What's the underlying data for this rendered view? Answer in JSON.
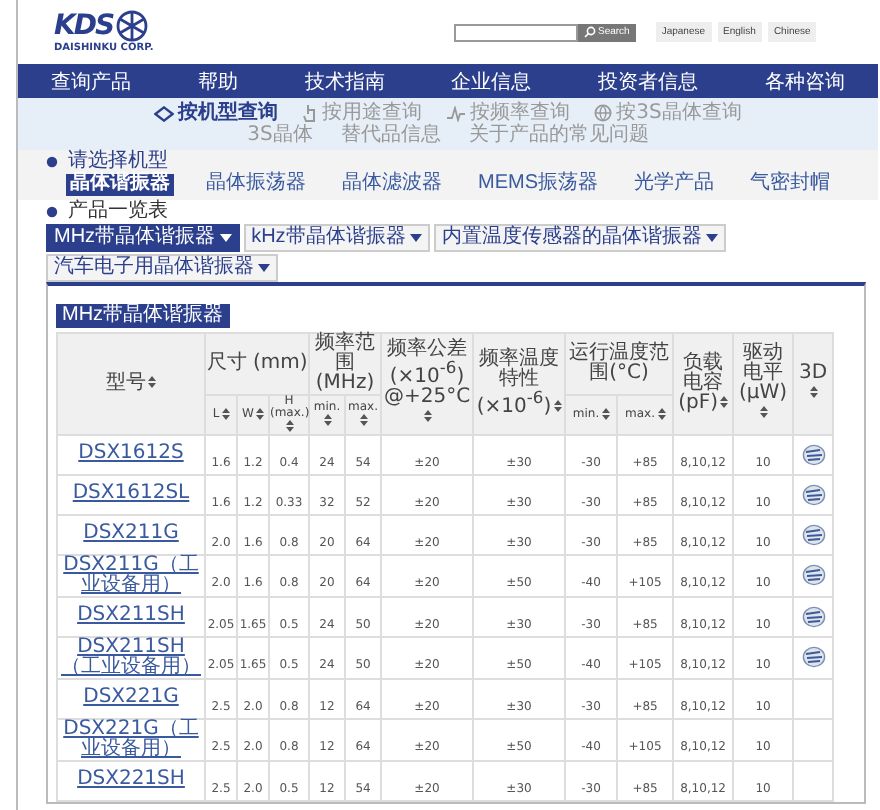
{
  "header": {
    "logo": {
      "mark": "KDS",
      "company": "DAISHINKU CORP."
    },
    "search": {
      "button": "Search"
    },
    "languages": [
      "Japanese",
      "English",
      "Chinese"
    ]
  },
  "nav": [
    "查询产品",
    "帮助",
    "技术指南",
    "企业信息",
    "投资者信息",
    "各种咨询"
  ],
  "search_modes": [
    {
      "label": "按机型查询",
      "selected": true
    },
    {
      "label": "按用途查询",
      "selected": false
    },
    {
      "label": "按频率查询",
      "selected": false
    },
    {
      "label": "按3S晶体查询",
      "selected": false
    }
  ],
  "sub_links": [
    "3S晶体",
    "替代品信息",
    "关于产品的常见问题"
  ],
  "category": {
    "label": "请选择机型",
    "items": [
      {
        "label": "晶体谐振器",
        "selected": true
      },
      {
        "label": "晶体振荡器",
        "selected": false
      },
      {
        "label": "晶体滤波器",
        "selected": false
      },
      {
        "label": "MEMS振荡器",
        "selected": false
      },
      {
        "label": "光学产品",
        "selected": false
      },
      {
        "label": "气密封帽",
        "selected": false
      }
    ]
  },
  "product_list": {
    "title": "产品一览表",
    "tabs": [
      {
        "label": "MHz带晶体谐振器",
        "selected": true
      },
      {
        "label": "kHz带晶体谐振器",
        "selected": false
      },
      {
        "label": "内置温度传感器的晶体谐振器",
        "selected": false
      },
      {
        "label": "汽车电子用晶体谐振器",
        "selected": false
      }
    ],
    "subtab": "MHz带晶体谐振器"
  },
  "table": {
    "columns": [
      {
        "label": "型号"
      },
      {
        "label": "尺寸 (mm)",
        "colspan": 3,
        "children": [
          {
            "label": "L"
          },
          {
            "label": "W"
          },
          {
            "label": "H (max.)"
          }
        ]
      },
      {
        "label": "频率范围(MHz)",
        "colspan": 2,
        "children": [
          {
            "label": "min."
          },
          {
            "label": "max."
          }
        ]
      },
      {
        "label": "频率公差 (×10$^{-6}$) @+25°C"
      },
      {
        "label": "频率温度特性 (×10$^{-6}$)"
      },
      {
        "label": "运行温度范围(°C)",
        "colspan": 2,
        "children": [
          {
            "label": "min."
          },
          {
            "label": "max."
          }
        ]
      },
      {
        "label": "负载电容 (pF)"
      },
      {
        "label": "驱动电平 (μW)"
      },
      {
        "label": "3D"
      }
    ],
    "rows": [
      {
        "cells": [
          "DSX1612S",
          "1.6",
          "1.2",
          "0.4",
          "24",
          "54",
          "±20",
          "±30",
          "-30",
          "+85",
          "8,10,12",
          "10"
        ],
        "model_3d": true
      },
      {
        "cells": [
          "DSX1612SL",
          "1.6",
          "1.2",
          "0.33",
          "32",
          "52",
          "±20",
          "±30",
          "-30",
          "+85",
          "8,10,12",
          "10"
        ],
        "model_3d": true
      },
      {
        "cells": [
          "DSX211G",
          "2.0",
          "1.6",
          "0.8",
          "20",
          "64",
          "±20",
          "±30",
          "-30",
          "+85",
          "8,10,12",
          "10"
        ],
        "model_3d": true
      },
      {
        "cells": [
          "DSX211G（工业设备用）",
          "2.0",
          "1.6",
          "0.8",
          "20",
          "64",
          "±20",
          "±50",
          "-40",
          "+105",
          "8,10,12",
          "10"
        ],
        "model_3d": true
      },
      {
        "cells": [
          "DSX211SH",
          "2.05",
          "1.65",
          "0.5",
          "24",
          "50",
          "±20",
          "±30",
          "-30",
          "+85",
          "8,10,12",
          "10"
        ],
        "model_3d": true
      },
      {
        "cells": [
          "DSX211SH（工业设备用）",
          "2.05",
          "1.65",
          "0.5",
          "24",
          "50",
          "±20",
          "±50",
          "-40",
          "+105",
          "8,10,12",
          "10"
        ],
        "model_3d": true
      },
      {
        "cells": [
          "DSX221G",
          "2.5",
          "2.0",
          "0.8",
          "12",
          "64",
          "±20",
          "±30",
          "-30",
          "+85",
          "8,10,12",
          "10"
        ],
        "model_3d": false
      },
      {
        "cells": [
          "DSX221G（工业设备用）",
          "2.5",
          "2.0",
          "0.8",
          "12",
          "64",
          "±20",
          "±50",
          "-40",
          "+105",
          "8,10,12",
          "10"
        ],
        "model_3d": false
      },
      {
        "cells": [
          "DSX221SH",
          "2.5",
          "2.0",
          "0.5",
          "12",
          "54",
          "±20",
          "±30",
          "-30",
          "+85",
          "8,10,12",
          "10"
        ],
        "model_3d": false
      }
    ]
  }
}
